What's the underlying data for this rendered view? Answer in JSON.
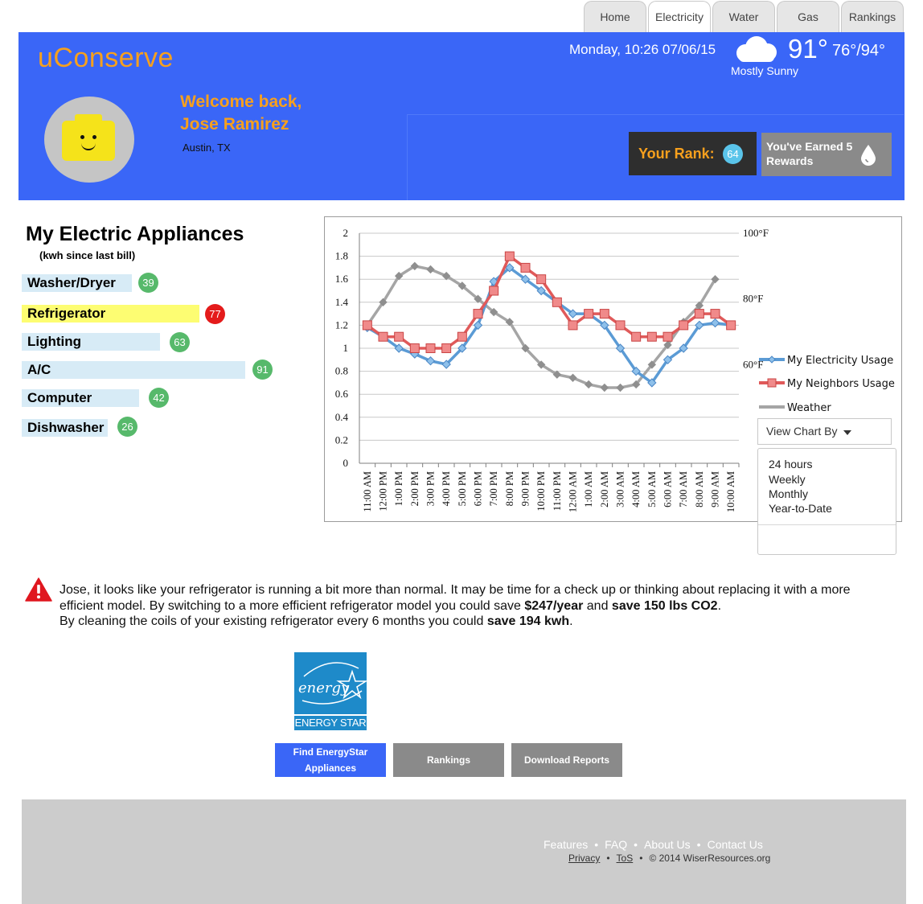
{
  "tabs": [
    "Home",
    "Electricity",
    "Water",
    "Gas",
    "Rankings"
  ],
  "header": {
    "logo": "uConserve",
    "welcome_line1": "Welcome back,",
    "welcome_line2": "Jose Ramirez",
    "location": "Austin, TX",
    "datetime": "Monday, 10:26 07/06/15",
    "temperature": "91°",
    "hilo": "76°/94°",
    "condition": "Mostly Sunny",
    "weather_icon": "cloud-icon",
    "rank_label": "Your Rank:",
    "rank_value": "64",
    "rewards_label": "You've Earned 5 Rewards",
    "rewards_icon": "water-drop-icon",
    "avatar_icon": "lego-head-icon"
  },
  "appliances": {
    "title": "My Electric Appliances",
    "subtitle": "(kwh since last bill)",
    "items": [
      {
        "label": "Washer/Dryer",
        "value": "39"
      },
      {
        "label": "Refrigerator",
        "value": "77"
      },
      {
        "label": "Lighting",
        "value": "63"
      },
      {
        "label": "A/C",
        "value": "91"
      },
      {
        "label": "Computer",
        "value": "42"
      },
      {
        "label": "Dishwasher",
        "value": "26"
      }
    ]
  },
  "colors": {
    "header_bg": "#3a66f7",
    "accent_orange": "#f7a01d",
    "badge_green": "#57b96b",
    "badge_red": "#e41b1b",
    "electricity_line": "#5b9bd5",
    "neighbors_line": "#e05a5a",
    "weather_line": "#a5a5a5"
  },
  "chart_data": {
    "type": "line",
    "categories": [
      "11:00 AM",
      "12:00 PM",
      "1:00 PM",
      "2:00 PM",
      "3:00 PM",
      "4:00 PM",
      "5:00 PM",
      "6:00 PM",
      "7:00 PM",
      "8:00 PM",
      "9:00 PM",
      "10:00 PM",
      "11:00 PM",
      "12:00 AM",
      "1:00 AM",
      "2:00 AM",
      "3:00 AM",
      "4:00 AM",
      "5:00 AM",
      "6:00 AM",
      "7:00 AM",
      "8:00 AM",
      "9:00 AM",
      "10:00 AM"
    ],
    "ylim": [
      0,
      2
    ],
    "yticks": [
      "0",
      "0.2",
      "0.4",
      "0.6",
      "0.8",
      "1",
      "1.2",
      "1.4",
      "1.6",
      "1.8",
      "2"
    ],
    "y2_ticks": [
      {
        "label": "100°F",
        "value": 100
      },
      {
        "label": "80°F",
        "value": 80
      },
      {
        "label": "60°F",
        "value": 60
      }
    ],
    "y2lim": [
      30,
      100
    ],
    "grid": true,
    "legend_position": "right",
    "series": [
      {
        "name": "My Electricity Usage",
        "axis": "left",
        "marker": "diamond",
        "values": [
          1.18,
          1.1,
          1.0,
          0.95,
          0.89,
          0.86,
          1.0,
          1.2,
          1.58,
          1.7,
          1.6,
          1.5,
          1.4,
          1.3,
          1.3,
          1.2,
          1.0,
          0.8,
          0.7,
          0.9,
          1.0,
          1.2,
          1.22,
          1.2
        ]
      },
      {
        "name": "My Neighbors Usage",
        "axis": "left",
        "marker": "square",
        "values": [
          1.2,
          1.1,
          1.1,
          1.0,
          1.0,
          1.0,
          1.1,
          1.3,
          1.5,
          1.8,
          1.7,
          1.6,
          1.4,
          1.2,
          1.3,
          1.3,
          1.2,
          1.1,
          1.1,
          1.1,
          1.2,
          1.3,
          1.3,
          1.2
        ]
      },
      {
        "name": "Weather",
        "axis": "right",
        "marker": "diamond",
        "values": [
          72,
          79,
          87,
          90,
          89,
          87,
          84,
          80,
          76,
          73,
          65,
          60,
          57,
          56,
          54,
          53,
          53,
          54,
          60,
          66,
          73,
          78,
          86
        ]
      }
    ],
    "view_label": "View Chart By",
    "view_options": [
      "24 hours",
      "Weekly",
      "Monthly",
      "Year-to-Date"
    ]
  },
  "alert": {
    "icon": "warning-icon",
    "p1": "Jose, it looks like your refrigerator is running a bit more than normal.  It may be time for a check up or thinking about replacing it with a more efficient model.  By switching to a more efficient refrigerator model you could save ",
    "b1": "$247/year",
    "p2": " and ",
    "b2": "save 150 lbs CO2",
    "p3": ".",
    "p4": "By cleaning the coils of your existing refrigerator every 6 months you could ",
    "b3": "save 194 kwh",
    "p5": "."
  },
  "energystar": {
    "label": "ENERGY STAR",
    "script": "energy"
  },
  "buttons": {
    "find": "Find EnergyStar Appliances",
    "rankings": "Rankings",
    "download": "Download Reports"
  },
  "footer": {
    "links": [
      "Features",
      "FAQ",
      "About Us",
      "Contact Us"
    ],
    "privacy": "Privacy",
    "tos": "ToS",
    "copyright": "© 2014 WiserResources.org",
    "separator": "•"
  }
}
